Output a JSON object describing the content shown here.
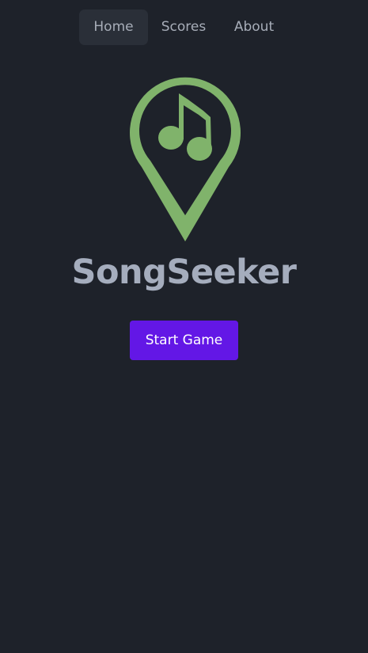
{
  "nav": {
    "items": [
      {
        "label": "Home",
        "active": true
      },
      {
        "label": "Scores",
        "active": false
      },
      {
        "label": "About",
        "active": false
      }
    ]
  },
  "logo": {
    "icon": "map-pin-music-note-icon",
    "color": "#80b36b"
  },
  "title": "SongSeeker",
  "start_button": {
    "label": "Start Game",
    "color": "#6317e6"
  },
  "colors": {
    "background": "#1e222a",
    "nav_active_bg": "#2a2f38",
    "nav_text": "#a7adb8",
    "title_text": "#a5adbd"
  }
}
